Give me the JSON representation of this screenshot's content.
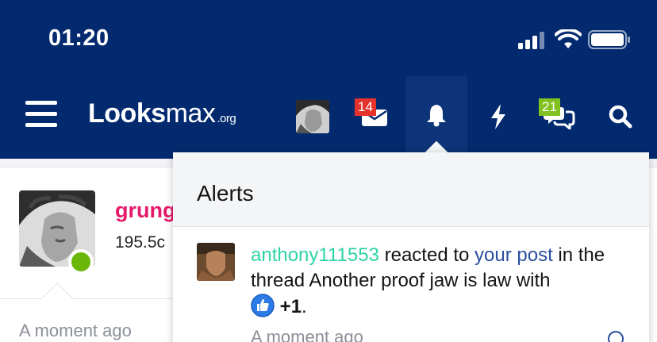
{
  "status_bar": {
    "time": "01:20"
  },
  "navbar": {
    "logo_bold": "Lo",
    "logo_mid": "oks",
    "logo_light": "max",
    "logo_suffix": ".org",
    "inbox_badge": "14",
    "conversations_badge": "21"
  },
  "post": {
    "username": "grung",
    "stat": "195.5c",
    "time": "A moment ago"
  },
  "alerts": {
    "title": "Alerts",
    "items": [
      {
        "user": "anthony111553",
        "action": "reacted to",
        "link": "your post",
        "text_a": "in",
        "text_b": "the thread Another proof jaw is law with",
        "reaction": "+1",
        "period": ".",
        "time": "A moment ago"
      }
    ]
  },
  "colors": {
    "header_bg": "#032a6f",
    "username_pink": "#e5186b",
    "online_green": "#6ab70a",
    "badge_red": "#e6322b",
    "badge_green": "#81c220",
    "link_blue": "#2a4f9e",
    "alert_user_teal": "#2dd4a6"
  },
  "icons": [
    "menu-icon",
    "mail-icon",
    "bell-icon",
    "bolt-icon",
    "chat-icon",
    "search-icon",
    "like-icon",
    "signal-icon",
    "wifi-icon",
    "battery-icon"
  ]
}
